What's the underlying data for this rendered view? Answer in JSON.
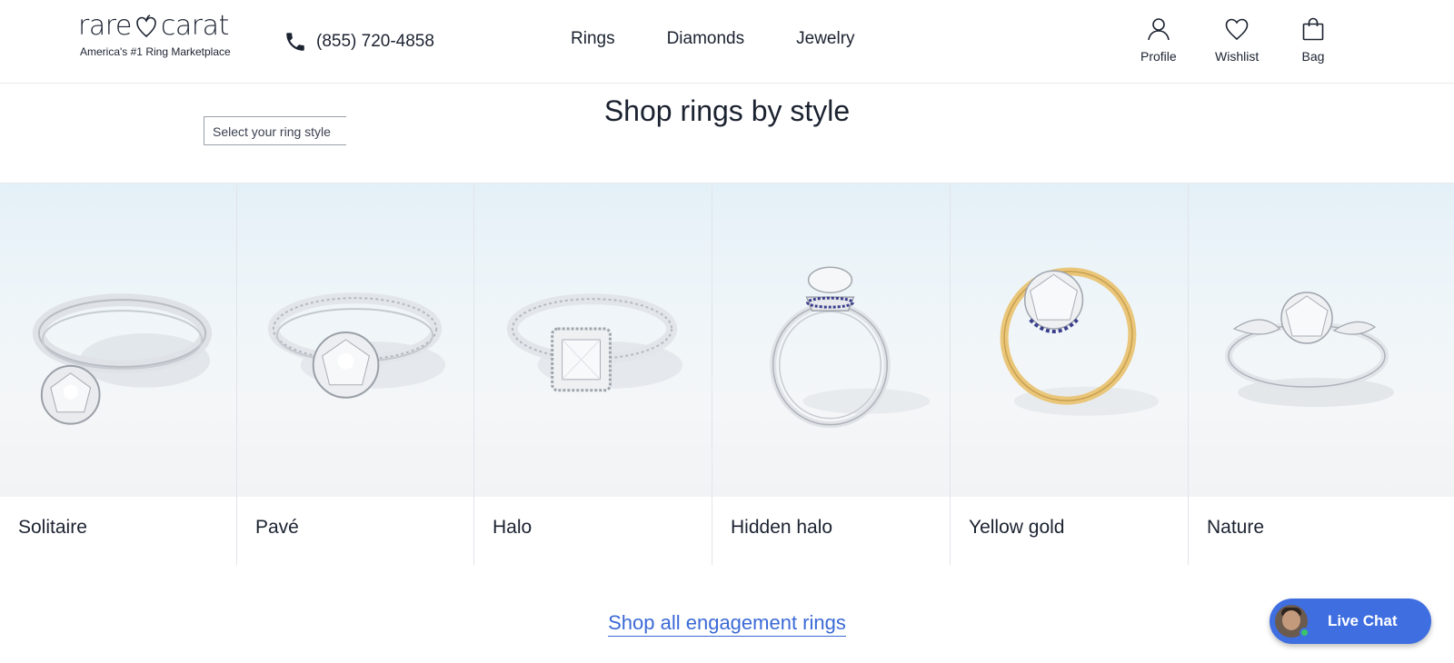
{
  "header": {
    "logo_text": "rare carat",
    "logo_tagline": "America's #1 Ring Marketplace",
    "phone": "(855) 720-4858",
    "nav": [
      "Rings",
      "Diamonds",
      "Jewelry"
    ],
    "profile_label": "Profile",
    "wishlist_label": "Wishlist",
    "bag_label": "Bag"
  },
  "section": {
    "title": "Shop rings by style",
    "select_placeholder": "Select your ring style"
  },
  "styles": [
    {
      "label": "Solitaire",
      "metal": "white"
    },
    {
      "label": "Pavé",
      "metal": "white"
    },
    {
      "label": "Halo",
      "metal": "white"
    },
    {
      "label": "Hidden halo",
      "metal": "white"
    },
    {
      "label": "Yellow gold",
      "metal": "yellow"
    },
    {
      "label": "Nature",
      "metal": "white"
    }
  ],
  "shop_all_label": "Shop all engagement rings",
  "live_chat_label": "Live Chat",
  "colors": {
    "text": "#1b2230",
    "link": "#3b6ad6",
    "chat": "#3f6ee0"
  }
}
